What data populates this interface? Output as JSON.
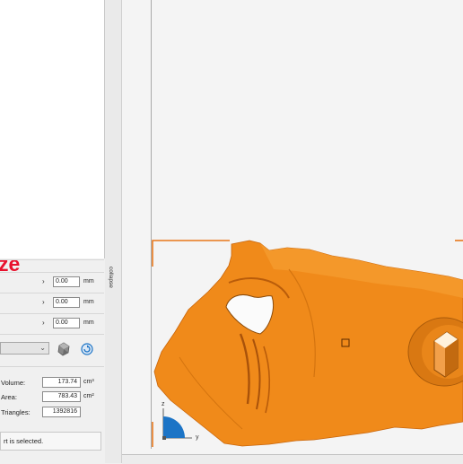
{
  "panel": {
    "heading": "ze",
    "rows": [
      {
        "arrow": "›",
        "value": "0.00",
        "unit": "mm"
      },
      {
        "arrow": "›",
        "value": "0.00",
        "unit": "mm"
      },
      {
        "arrow": "›",
        "value": "0.00",
        "unit": "mm"
      }
    ],
    "dropdown_chevron": "⌄",
    "stats": [
      {
        "label": "Volume:",
        "value": "173.74",
        "unit": "cm³"
      },
      {
        "label": "Area:",
        "value": "783.43",
        "unit": "cm²"
      },
      {
        "label": "Triangles:",
        "value": "1392816",
        "unit": ""
      }
    ],
    "status": "rt is selected."
  },
  "collapse": {
    "label": "collapse"
  },
  "axes": {
    "z": "z",
    "y": "y"
  },
  "colors": {
    "model": "#f08a1a",
    "selection": "#e8771a",
    "axis_blue": "#1c74c6",
    "heading_red": "#e8112d"
  }
}
